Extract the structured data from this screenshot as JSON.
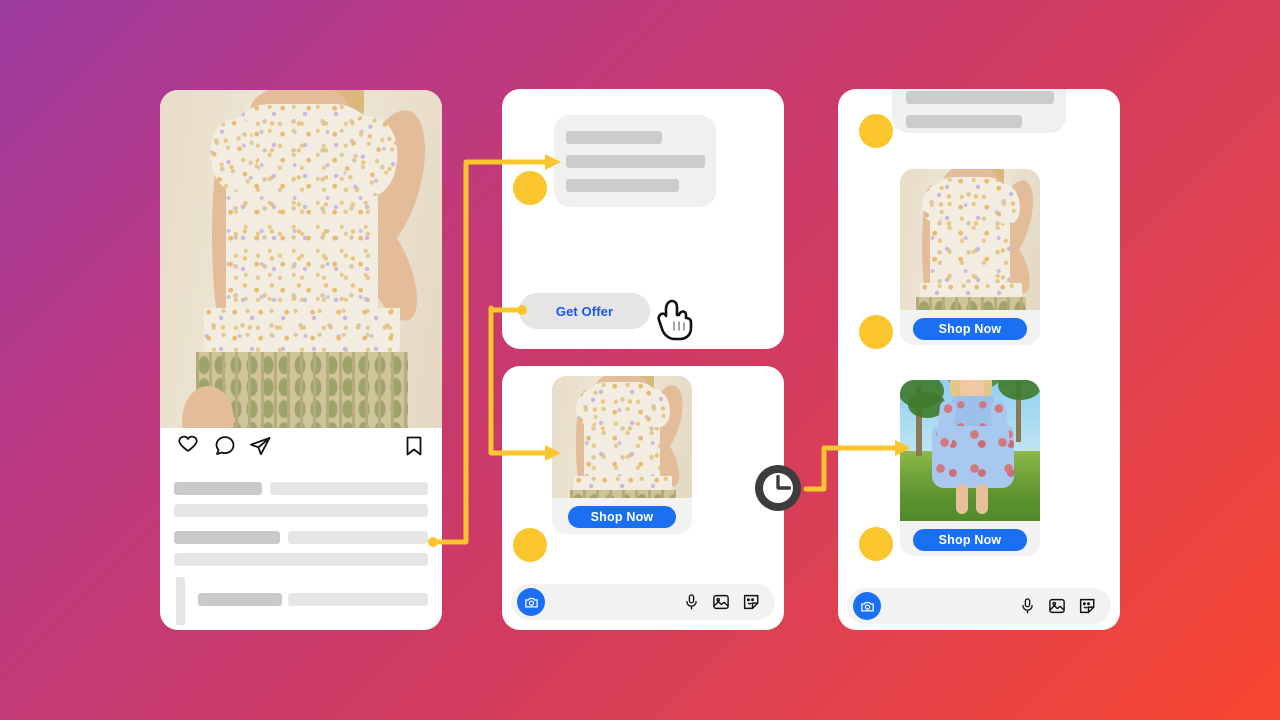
{
  "scene": {
    "title": "Instagram to Messenger product offer flow",
    "background_gradient_start": "#9b3a9f",
    "background_gradient_mid": "#cc3a66",
    "background_gradient_end": "#f7462f",
    "accent_yellow": "#fbc52d",
    "accent_blue": "#1a6ff2",
    "link_blue": "#1a56f0"
  },
  "instagram_post": {
    "name": "Instagram post card",
    "photo_alt": "Model wearing cream floral ruffle-sleeve tiered mini dress",
    "actions": [
      {
        "icon": "heart-icon",
        "label": "Like"
      },
      {
        "icon": "comment-icon",
        "label": "Comment"
      },
      {
        "icon": "share-icon",
        "label": "Share"
      },
      {
        "icon": "bookmark-icon",
        "label": "Save"
      }
    ],
    "caption_placeholder_rows": [
      {
        "dark_width": 88,
        "light_width": 160
      },
      {
        "dark_width": 0,
        "light_width": 252
      },
      {
        "dark_width": 105,
        "light_width": 145
      },
      {
        "dark_width": 0,
        "light_width": 252
      }
    ],
    "comment_placeholder": {
      "dark_width": 85,
      "light_width": 140
    }
  },
  "messenger_offer": {
    "name": "Messenger offer thread",
    "incoming_bubble_lines": [
      96,
      158,
      120
    ],
    "avatar_label": "Brand avatar",
    "get_offer_button": "Get Offer",
    "cursor_icon": "pointing-hand-cursor"
  },
  "messenger_product": {
    "name": "Messenger product card thread",
    "product_image_alt": "Cream floral ruffle-sleeve mini dress",
    "shop_now_button": "Shop Now",
    "avatar_label": "Brand avatar",
    "input_bar": {
      "camera_icon": "camera-icon",
      "icons": [
        {
          "icon": "microphone-icon",
          "label": "Voice message"
        },
        {
          "icon": "photo-icon",
          "label": "Gallery"
        },
        {
          "icon": "sticker-icon",
          "label": "Stickers"
        }
      ]
    }
  },
  "messenger_followup": {
    "name": "Messenger follow-up thread",
    "top_bubble_lines": [
      150,
      118
    ],
    "product_one_alt": "Cream floral ruffle-sleeve mini dress",
    "product_one_button": "Shop Now",
    "product_two_alt": "Blue and red print long-sleeve tiered mini dress outdoors",
    "product_two_button": "Shop Now",
    "avatar_label": "Brand avatar",
    "input_bar": {
      "camera_icon": "camera-icon",
      "icons": [
        {
          "icon": "microphone-icon",
          "label": "Voice message"
        },
        {
          "icon": "photo-icon",
          "label": "Gallery"
        },
        {
          "icon": "sticker-icon",
          "label": "Stickers"
        }
      ]
    }
  },
  "connectors": {
    "name": "Flow arrows",
    "color": "#fbc52d",
    "delay_badge": {
      "icon": "clock-icon",
      "label": "Time delay"
    }
  }
}
